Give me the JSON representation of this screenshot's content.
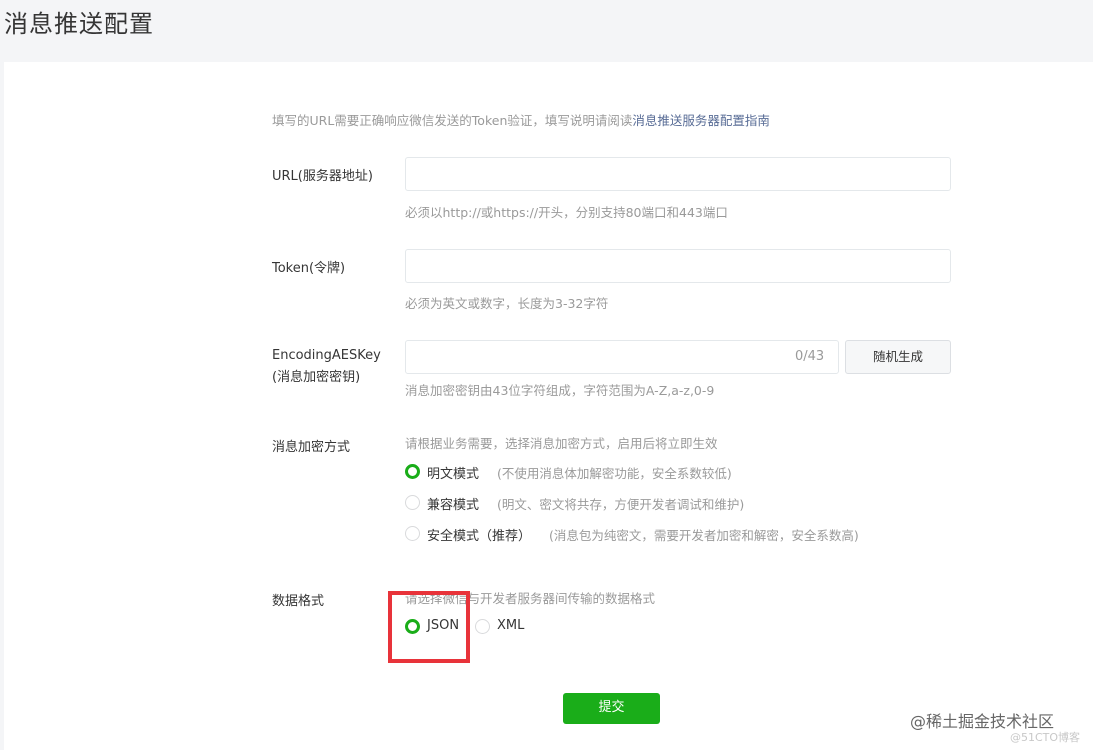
{
  "page": {
    "title": "消息推送配置"
  },
  "intro": {
    "text": "填写的URL需要正确响应微信发送的Token验证，填写说明请阅读",
    "link": "消息推送服务器配置指南"
  },
  "fields": {
    "url": {
      "label": "URL(服务器地址)",
      "value": "",
      "placeholder": "",
      "hint": "必须以http://或https://开头，分别支持80端口和443端口"
    },
    "token": {
      "label": "Token(令牌)",
      "value": "",
      "placeholder": "",
      "hint": "必须为英文或数字，长度为3-32字符"
    },
    "aeskey": {
      "label_line1": "EncodingAESKey",
      "label_line2": "(消息加密密钥)",
      "value": "",
      "counter": "0/43",
      "generate_button": "随机生成",
      "hint": "消息加密密钥由43位字符组成，字符范围为A-Z,a-z,0-9"
    }
  },
  "encryption": {
    "label": "消息加密方式",
    "hint": "请根据业务需要，选择消息加密方式，启用后将立即生效",
    "options": [
      {
        "label": "明文模式",
        "desc": "(不使用消息体加解密功能，安全系数较低)",
        "selected": true
      },
      {
        "label": "兼容模式",
        "desc": "(明文、密文将共存，方便开发者调试和维护)",
        "selected": false
      },
      {
        "label": "安全模式（推荐）",
        "desc": "(消息包为纯密文，需要开发者加密和解密，安全系数高)",
        "selected": false
      }
    ]
  },
  "data_format": {
    "label": "数据格式",
    "hint": "请选择微信与开发者服务器间传输的数据格式",
    "options": [
      {
        "label": "JSON",
        "selected": true
      },
      {
        "label": "XML",
        "selected": false
      }
    ]
  },
  "submit": {
    "label": "提交"
  },
  "watermark": {
    "line1": "@稀土掘金技术社区",
    "line2": "@51CTO博客"
  },
  "colors": {
    "accent": "#1aad19",
    "link": "#576b95",
    "highlight": "#e8333a"
  }
}
